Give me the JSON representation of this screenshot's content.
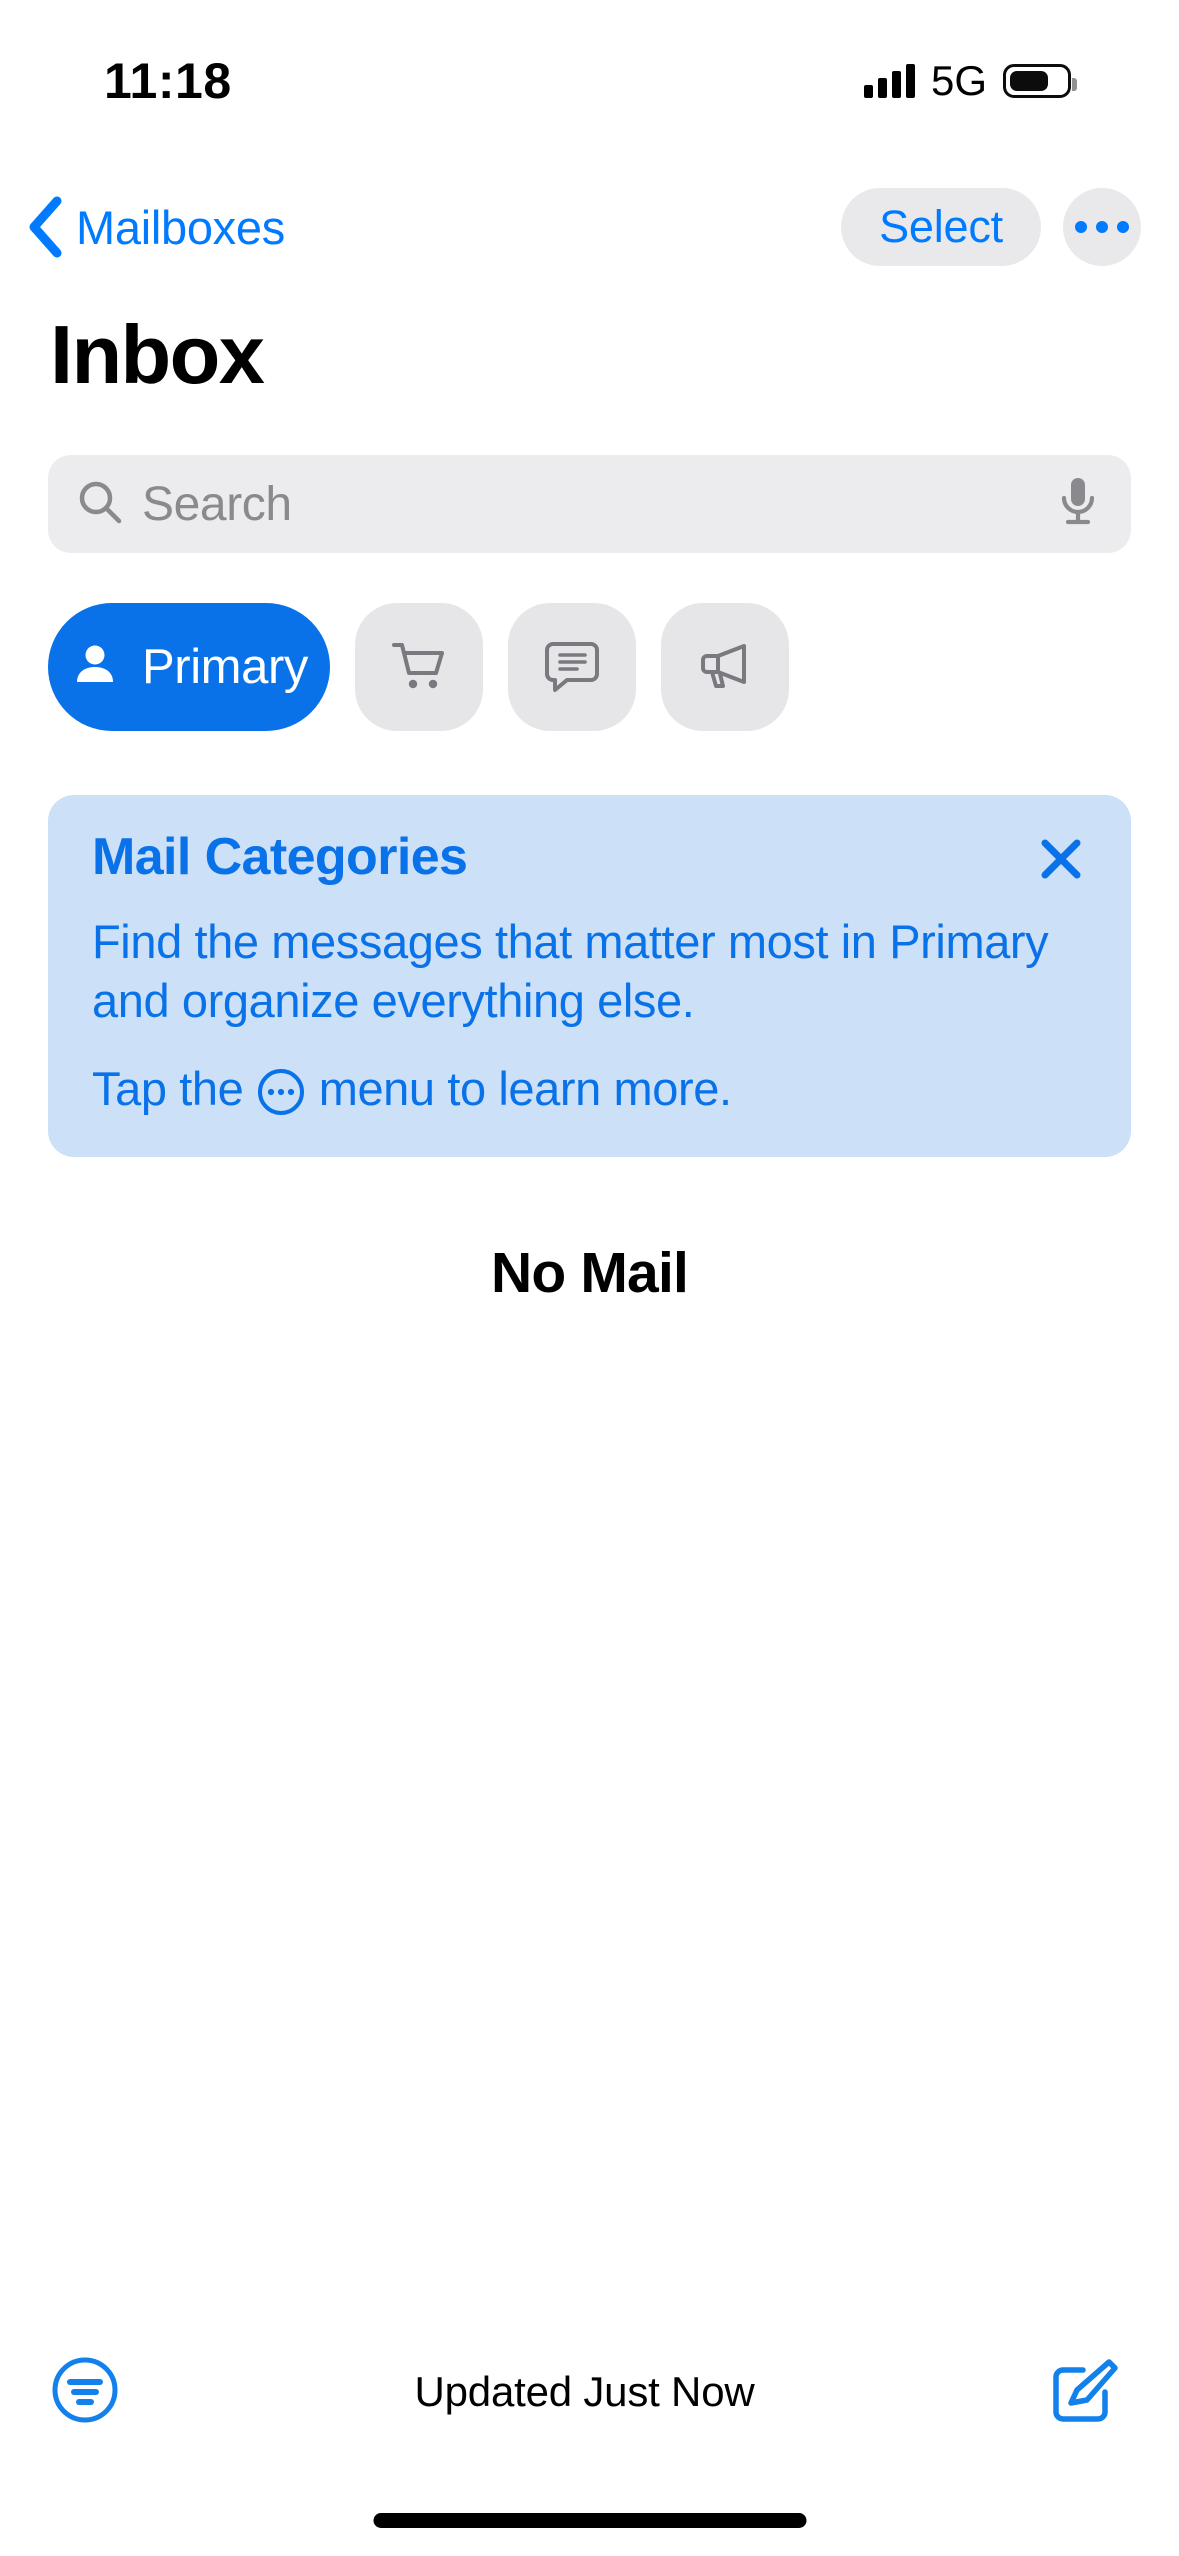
{
  "status_bar": {
    "time": "11:18",
    "network": "5G",
    "signal_bars": 4,
    "battery_level": "full"
  },
  "nav_bar": {
    "back_label": "Mailboxes",
    "back_icon": "chevron-left-icon",
    "select_label": "Select",
    "more_icon": "ellipsis-icon"
  },
  "header": {
    "title": "Inbox"
  },
  "search": {
    "placeholder": "Search",
    "value": "",
    "search_icon": "magnifying-glass-icon",
    "dictation_icon": "microphone-icon"
  },
  "categories": [
    {
      "id": "primary",
      "label": "Primary",
      "icon": "person-icon",
      "selected": true
    },
    {
      "id": "transactions",
      "label": "",
      "icon": "shopping-cart-icon",
      "selected": false
    },
    {
      "id": "updates",
      "label": "",
      "icon": "chat-bubble-icon",
      "selected": false
    },
    {
      "id": "promotions",
      "label": "",
      "icon": "megaphone-icon",
      "selected": false
    }
  ],
  "banner": {
    "title": "Mail Categories",
    "body": "Find the messages that matter most in Primary and organize everything else.",
    "hint_before": "Tap the ",
    "hint_icon": "circle-ellipsis-icon",
    "hint_after": " menu to learn more.",
    "close_icon": "close-icon"
  },
  "message_list": {
    "empty_title": "No Mail",
    "items": []
  },
  "toolbar": {
    "filter_icon": "filter-icon",
    "status_text": "Updated Just Now",
    "compose_icon": "compose-icon"
  },
  "colors": {
    "accent_blue": "#007AFF",
    "pill_blue": "#0A72E8",
    "banner_bg": "#CCE0F7",
    "field_gray": "#ECECEE",
    "pill_gray": "#E6E6E8",
    "icon_gray": "#8A8A8E"
  }
}
